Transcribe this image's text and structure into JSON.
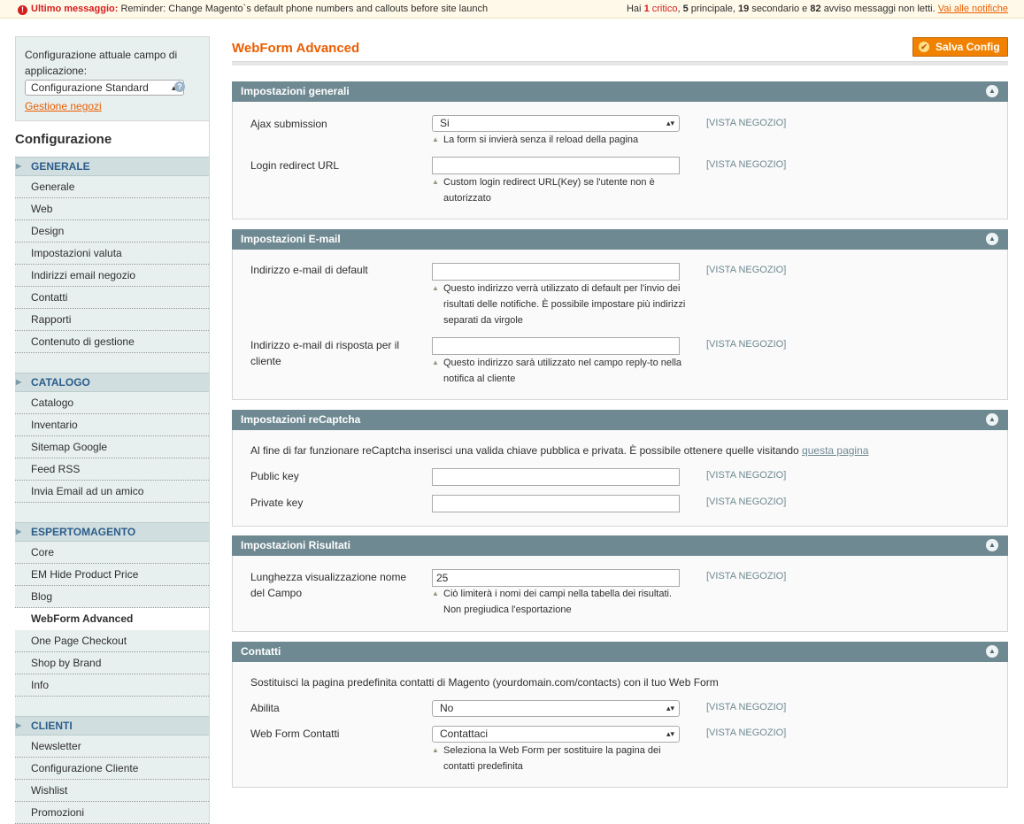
{
  "notice": {
    "label": "Ultimo messaggio:",
    "text": "Reminder: Change Magento`s default phone numbers and callouts before site launch",
    "summary_prefix": "Hai",
    "critical_count": "1",
    "critical_label": "critico",
    "major_count": "5",
    "major_label": "principale,",
    "minor_count": "19",
    "minor_label": "secondario e",
    "notice_count": "82",
    "notice_label": "avviso messaggi non letti.",
    "link": "Vai alle notifiche"
  },
  "sidebar": {
    "scope_label": "Configurazione attuale campo di applicazione:",
    "scope_value": "Configurazione Standard",
    "manage_stores": "Gestione negozi",
    "title": "Configurazione",
    "sections": [
      {
        "title": "GENERALE",
        "items": [
          "Generale",
          "Web",
          "Design",
          "Impostazioni valuta",
          "Indirizzi email negozio",
          "Contatti",
          "Rapporti",
          "Contenuto di gestione"
        ]
      },
      {
        "title": "CATALOGO",
        "items": [
          "Catalogo",
          "Inventario",
          "Sitemap Google",
          "Feed RSS",
          "Invia Email ad un amico"
        ]
      },
      {
        "title": "ESPERTOMAGENTO",
        "items": [
          "Core",
          "EM Hide Product Price",
          "Blog",
          "WebForm Advanced",
          "One Page Checkout",
          "Shop by Brand",
          "Info"
        ]
      },
      {
        "title": "CLIENTI",
        "items": [
          "Newsletter",
          "Configurazione Cliente",
          "Wishlist",
          "Promozioni"
        ]
      }
    ]
  },
  "main": {
    "title": "WebForm Advanced",
    "save_label": "Salva Config",
    "scope_label": "[VISTA NEGOZIO]",
    "general": {
      "title": "Impostazioni generali",
      "ajax_label": "Ajax submission",
      "ajax_value": "Si",
      "ajax_note": "La form si invierà senza il reload della pagina",
      "login_label": "Login redirect URL",
      "login_value": "",
      "login_note": "Custom login redirect URL(Key) se l'utente non è autorizzato"
    },
    "email": {
      "title": "Impostazioni E-mail",
      "default_label": "Indirizzo e-mail di default",
      "default_value": "",
      "default_note": "Questo indirizzo verrà utilizzato di default per l'invio dei risultati delle notifiche. È possibile impostare più indirizzi separati da virgole",
      "reply_label": "Indirizzo e-mail di risposta per il cliente",
      "reply_value": "",
      "reply_note": "Questo indirizzo sarà utilizzato nel campo reply-to nella notifica al cliente"
    },
    "recaptcha": {
      "title": "Impostazioni reCaptcha",
      "intro": "Al fine di far funzionare reCaptcha inserisci una valida chiave pubblica e privata. È possibile ottenere quelle visitando",
      "intro_link": "questa pagina",
      "public_label": "Public key",
      "public_value": "",
      "private_label": "Private key",
      "private_value": ""
    },
    "results": {
      "title": "Impostazioni Risultati",
      "length_label": "Lunghezza visualizzazione nome del Campo",
      "length_value": "25",
      "length_note": "Ciò limiterà i nomi dei campi nella tabella dei risultati. Non pregiudica l'esportazione"
    },
    "contacts": {
      "title": "Contatti",
      "intro": "Sostituisci la pagina predefinita contatti di Magento (yourdomain.com/contacts) con il tuo Web Form",
      "enable_label": "Abilita",
      "enable_value": "No",
      "form_label": "Web Form Contatti",
      "form_value": "Contattaci",
      "form_note": "Seleziona la Web Form per sostituire la pagina dei contatti predefinita"
    }
  }
}
